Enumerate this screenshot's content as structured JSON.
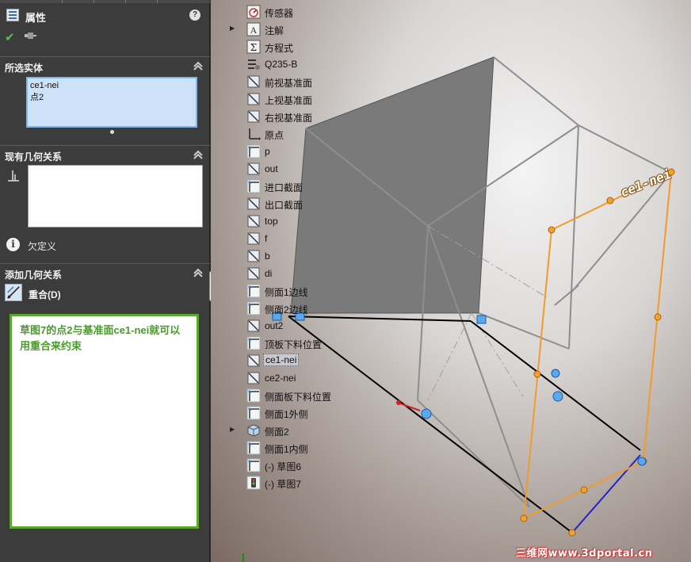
{
  "panel": {
    "title": "属性",
    "help_label": "?",
    "selected_section": {
      "title": "所选实体",
      "items": [
        "ce1-nei",
        "点2"
      ]
    },
    "existing_relations_section": {
      "title": "现有几何关系",
      "status": "欠定义"
    },
    "add_relations_section": {
      "title": "添加几何关系",
      "coincident_label": "重合(D)"
    },
    "note_text": "草图7的点2与基准面ce1-nei就可以用重合来约束"
  },
  "tree": {
    "items": [
      {
        "label": "传感器",
        "icon": "sensor-icon",
        "expandable": false
      },
      {
        "label": "注解",
        "icon": "annotation-icon",
        "expandable": true
      },
      {
        "label": "方程式",
        "icon": "equation-icon",
        "expandable": false
      },
      {
        "label": "Q235-B",
        "icon": "material-icon",
        "expandable": false
      },
      {
        "label": "前视基准面",
        "icon": "plane-icon",
        "expandable": false
      },
      {
        "label": "上视基准面",
        "icon": "plane-icon",
        "expandable": false
      },
      {
        "label": "右视基准面",
        "icon": "plane-icon",
        "expandable": false
      },
      {
        "label": "原点",
        "icon": "origin-icon",
        "expandable": false
      },
      {
        "label": "p",
        "icon": "sketch-icon",
        "expandable": false
      },
      {
        "label": "out",
        "icon": "plane-icon",
        "expandable": false
      },
      {
        "label": "进口截面",
        "icon": "sketch-icon",
        "expandable": false
      },
      {
        "label": "出口截面",
        "icon": "plane-icon",
        "expandable": false
      },
      {
        "label": "top",
        "icon": "plane-icon",
        "expandable": false
      },
      {
        "label": "f",
        "icon": "plane-icon",
        "expandable": false
      },
      {
        "label": "b",
        "icon": "plane-icon",
        "expandable": false
      },
      {
        "label": "di",
        "icon": "plane-icon",
        "expandable": false
      },
      {
        "label": "侧面1边线",
        "icon": "sketch-icon",
        "expandable": false
      },
      {
        "label": "侧面2边线",
        "icon": "sketch-icon",
        "expandable": false
      },
      {
        "label": "out2",
        "icon": "plane-icon",
        "expandable": false
      },
      {
        "label": "顶板下料位置",
        "icon": "sketch-icon",
        "expandable": false
      },
      {
        "label": "ce1-nei",
        "icon": "plane-icon",
        "expandable": false,
        "selected": true
      },
      {
        "label": "ce2-nei",
        "icon": "plane-icon",
        "expandable": false
      },
      {
        "label": "侧面板下料位置",
        "icon": "sketch-icon",
        "expandable": false
      },
      {
        "label": "侧面1外侧",
        "icon": "sketch-icon",
        "expandable": false
      },
      {
        "label": "侧面2",
        "icon": "part-icon",
        "expandable": true
      },
      {
        "label": "侧面1内侧",
        "icon": "sketch-icon",
        "expandable": false
      },
      {
        "label": "(-) 草图6",
        "icon": "sketch-icon",
        "expandable": false
      },
      {
        "label": "(-) 草图7",
        "icon": "sketch-edit-icon",
        "expandable": false
      }
    ]
  },
  "viewport": {
    "plane_label": "ce1-nei",
    "watermark": "三维网www.3dportal.cn",
    "colors": {
      "highlight": "#f39a2c",
      "sketch_line": "#000000",
      "blue_line": "#2222cc",
      "panel_fill": "#7a7a7a"
    }
  }
}
